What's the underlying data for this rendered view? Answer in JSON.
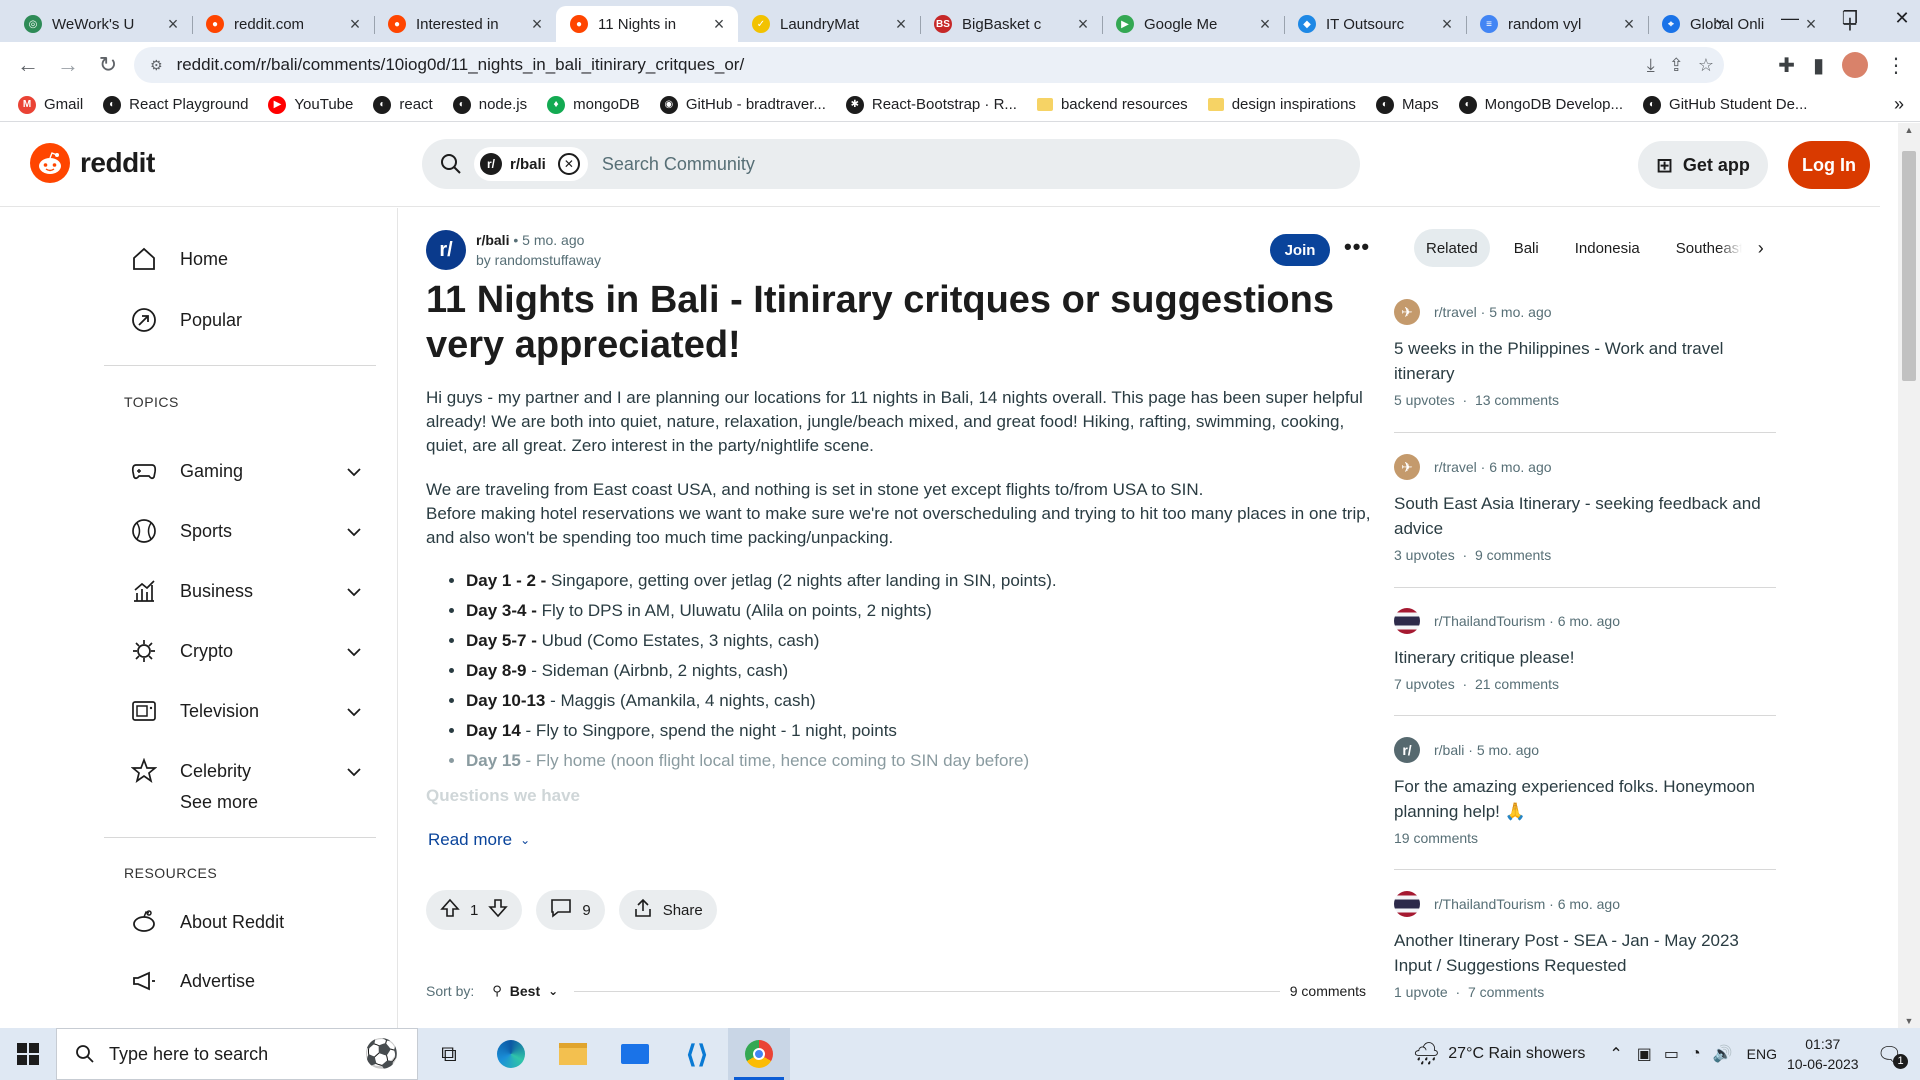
{
  "browser": {
    "tabs": [
      {
        "title": "WeWork's U",
        "color": "#2e8b57",
        "glyph": "◎"
      },
      {
        "title": "reddit.com",
        "color": "#ff4500",
        "glyph": "●"
      },
      {
        "title": "Interested in",
        "color": "#ff4500",
        "glyph": "●"
      },
      {
        "title": "11 Nights in",
        "color": "#ff4500",
        "glyph": "●",
        "active": true
      },
      {
        "title": "LaundryMat",
        "color": "#f2c200",
        "glyph": "✓"
      },
      {
        "title": "BigBasket c",
        "color": "#c62828",
        "glyph": "BS"
      },
      {
        "title": "Google Me",
        "color": "#34a853",
        "glyph": "▶"
      },
      {
        "title": "IT Outsourc",
        "color": "#1e88e5",
        "glyph": "◆"
      },
      {
        "title": "random vyl",
        "color": "#4285f4",
        "glyph": "≡"
      },
      {
        "title": "Global Onli",
        "color": "#1a73e8",
        "glyph": "⌖"
      }
    ],
    "url": "reddit.com/r/bali/comments/10iog0d/11_nights_in_bali_itinirary_critques_or/",
    "bookmarks": [
      {
        "label": "Gmail",
        "color": "#ea4335",
        "glyph": "M"
      },
      {
        "label": "React Playground",
        "color": "#1c1c1c",
        "glyph": "◐"
      },
      {
        "label": "YouTube",
        "color": "#ff0000",
        "glyph": "▶"
      },
      {
        "label": "react",
        "color": "#1c1c1c",
        "glyph": "◐"
      },
      {
        "label": "node.js",
        "color": "#1c1c1c",
        "glyph": "◐"
      },
      {
        "label": "mongoDB",
        "color": "#13aa52",
        "glyph": "♦"
      },
      {
        "label": "GitHub - bradtraver...",
        "color": "#1c1c1c",
        "glyph": "◉"
      },
      {
        "label": "React-Bootstrap · R...",
        "color": "#1c1c1c",
        "glyph": "✱"
      },
      {
        "label": "backend resources",
        "color": "#f6d365",
        "glyph": ""
      },
      {
        "label": "design inspirations",
        "color": "#f6d365",
        "glyph": ""
      },
      {
        "label": "Maps",
        "color": "#1c1c1c",
        "glyph": "◐"
      },
      {
        "label": "MongoDB Develop...",
        "color": "#1c1c1c",
        "glyph": "◐"
      },
      {
        "label": "GitHub Student De...",
        "color": "#1c1c1c",
        "glyph": "◐"
      }
    ],
    "bookmarks_more": "»"
  },
  "header": {
    "logo_text": "reddit",
    "search_chip": "r/bali",
    "search_placeholder": "Search Community",
    "get_app": "Get app",
    "login": "Log In"
  },
  "leftnav": {
    "home": "Home",
    "popular": "Popular",
    "topics_heading": "TOPICS",
    "topics": [
      "Gaming",
      "Sports",
      "Business",
      "Crypto",
      "Television",
      "Celebrity"
    ],
    "see_more": "See more",
    "resources_heading": "RESOURCES",
    "resources": [
      "About Reddit",
      "Advertise"
    ]
  },
  "post": {
    "subreddit": "r/bali",
    "age": "5 mo. ago",
    "author": "by randomstuffaway",
    "join": "Join",
    "title": "11 Nights in Bali - Itinirary critques or suggestions very appreciated!",
    "para1": "Hi guys - my partner and I are planning our locations for 11 nights in Bali, 14 nights overall. This page has been super helpful already! We are both into quiet, nature, relaxation, jungle/beach mixed, and great food! Hiking, rafting, swimming, cooking, quiet, are all great. Zero interest in the party/nightlife scene.",
    "para2a": "We are traveling from East coast USA, and nothing is set in stone yet except flights to/from USA to SIN.",
    "para2b": "Before making hotel reservations we want to make sure we're not overscheduling and trying to hit too many places in one trip, and also won't be spending too much time packing/unpacking.",
    "days": [
      {
        "day": "Day 1 - 2 -",
        "text": " Singapore, getting over jetlag (2 nights after landing in SIN, points)."
      },
      {
        "day": "Day 3-4 -",
        "text": " Fly to DPS in AM, Uluwatu (Alila on points, 2 nights)"
      },
      {
        "day": "Day 5-7 -",
        "text": " Ubud (Como Estates, 3 nights, cash)"
      },
      {
        "day": "Day 8-9",
        "text": " - Sideman (Airbnb, 2 nights, cash)"
      },
      {
        "day": "Day 10-13",
        "text": " - Maggis (Amankila, 4 nights, cash)"
      },
      {
        "day": "Day 14",
        "text": " - Fly to Singpore, spend the night - 1 night, points"
      },
      {
        "day": "Day 15",
        "text": " - Fly home (noon flight local time, hence coming to SIN day before)"
      }
    ],
    "faded_heading": "Questions we have",
    "read_more": "Read more",
    "votes": "1",
    "comments": "9",
    "share": "Share",
    "sort_label": "Sort by:",
    "sort_value": "Best",
    "comment_count": "9 comments"
  },
  "sidebar": {
    "tabs": [
      "Related",
      "Bali",
      "Indonesia",
      "Southeast Asia"
    ],
    "related": [
      {
        "sub": "r/travel",
        "age": "5 mo. ago",
        "title": "5 weeks in the Philippines - Work and travel itinerary",
        "upvotes": "5 upvotes",
        "comments": "13 comments",
        "icon_color": "#c49a6c",
        "icon_glyph": "✈"
      },
      {
        "sub": "r/travel",
        "age": "6 mo. ago",
        "title": "South East Asia Itinerary - seeking feedback and advice",
        "upvotes": "3 upvotes",
        "comments": "9 comments",
        "icon_color": "#c49a6c",
        "icon_glyph": "✈"
      },
      {
        "sub": "r/ThailandTourism",
        "age": "6 mo. ago",
        "title": "Itinerary critique please!",
        "upvotes": "7 upvotes",
        "comments": "21 comments",
        "icon_color": "#a51931",
        "icon_glyph": ""
      },
      {
        "sub": "r/bali",
        "age": "5 mo. ago",
        "title": "For the amazing experienced folks. Honeymoon planning help! 🙏",
        "upvotes": "",
        "comments": "19 comments",
        "icon_color": "#56696f",
        "icon_glyph": "r/"
      },
      {
        "sub": "r/ThailandTourism",
        "age": "6 mo. ago",
        "title": "Another Itinerary Post - SEA - Jan - May 2023 Input / Suggestions Requested",
        "upvotes": "1 upvote",
        "comments": "7 comments",
        "icon_color": "#a51931",
        "icon_glyph": ""
      }
    ]
  },
  "taskbar": {
    "search_placeholder": "Type here to search",
    "weather": "27°C  Rain showers",
    "lang": "ENG",
    "time": "01:37",
    "date": "10-06-2023",
    "notifications": "1"
  }
}
